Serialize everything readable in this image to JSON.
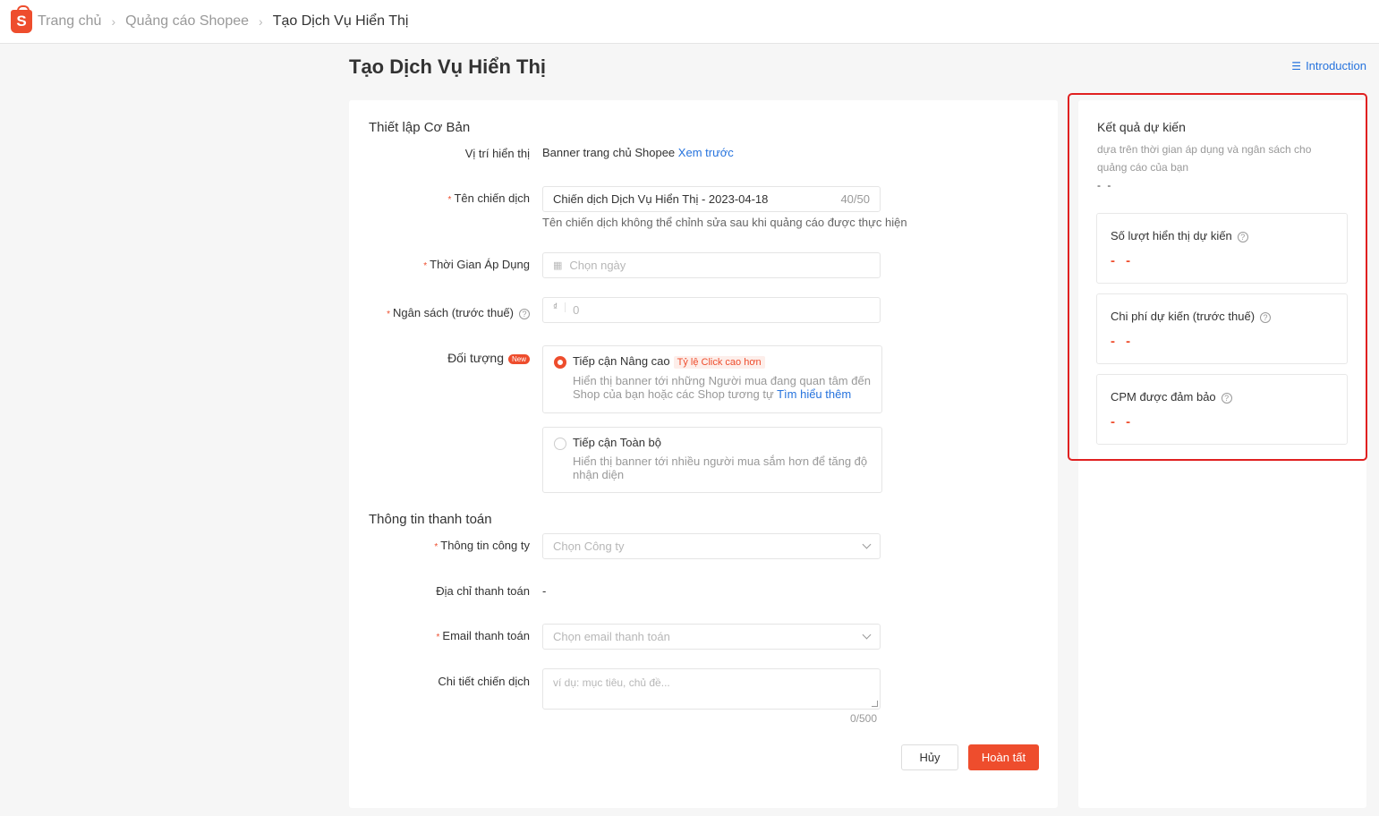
{
  "breadcrumb": {
    "logo_letter": "S",
    "home": "Trang chủ",
    "ads": "Quảng cáo Shopee",
    "current": "Tạo Dịch Vụ Hiển Thị"
  },
  "page": {
    "title": "Tạo Dịch Vụ Hiển Thị",
    "intro_link": "Introduction"
  },
  "basic": {
    "section_title": "Thiết lập Cơ Bản",
    "placement_label": "Vị trí hiển thị",
    "placement_value": "Banner trang chủ Shopee",
    "preview_link": "Xem trước",
    "name_label": "Tên chiến dịch",
    "name_value": "Chiến dịch Dịch Vụ Hiển Thị - 2023-04-18",
    "name_counter": "40/50",
    "name_hint": "Tên chiến dịch không thể chỉnh sửa sau khi quảng cáo được thực hiện",
    "time_label": "Thời Gian Áp Dụng",
    "time_placeholder": "Chọn ngày",
    "budget_label": "Ngân sách (trước thuế)",
    "currency": "₫",
    "budget_placeholder": "0",
    "audience_label": "Đối tượng",
    "new_badge": "New",
    "option1_title": "Tiếp cận Nâng cao",
    "option1_tag": "Tỷ lệ Click cao hơn",
    "option1_desc": "Hiển thị banner tới những Người mua đang quan tâm đến Shop của bạn hoặc các Shop tương tự",
    "option1_link": "Tìm hiểu thêm",
    "option2_title": "Tiếp cận Toàn bộ",
    "option2_desc": "Hiển thị banner tới nhiều người mua sắm hơn để tăng độ nhận diện"
  },
  "payment": {
    "section_title": "Thông tin thanh toán",
    "company_label": "Thông tin công ty",
    "company_placeholder": "Chọn Công ty",
    "address_label": "Địa chỉ thanh toán",
    "address_value": "-",
    "email_label": "Email thanh toán",
    "email_placeholder": "Chọn email thanh toán",
    "details_label": "Chi tiết chiến dịch",
    "details_placeholder": "ví dụ: mục tiêu, chủ đề...",
    "details_counter": "0/500"
  },
  "actions": {
    "cancel": "Hủy",
    "done": "Hoàn tất"
  },
  "forecast": {
    "title": "Kết quả dự kiến",
    "subtitle": "dựa trên thời gian áp dụng và ngân sách cho quảng cáo của bạn",
    "summary": "- -",
    "metrics": [
      {
        "label": "Số lượt hiển thị dự kiến",
        "value": "- -"
      },
      {
        "label": "Chi phí dự kiến (trước thuế)",
        "value": "- -"
      },
      {
        "label": "CPM được đảm bảo",
        "value": "- -"
      }
    ]
  },
  "colors": {
    "brand": "#ee4d2d",
    "link": "#2673dd",
    "highlight": "#e02020"
  }
}
